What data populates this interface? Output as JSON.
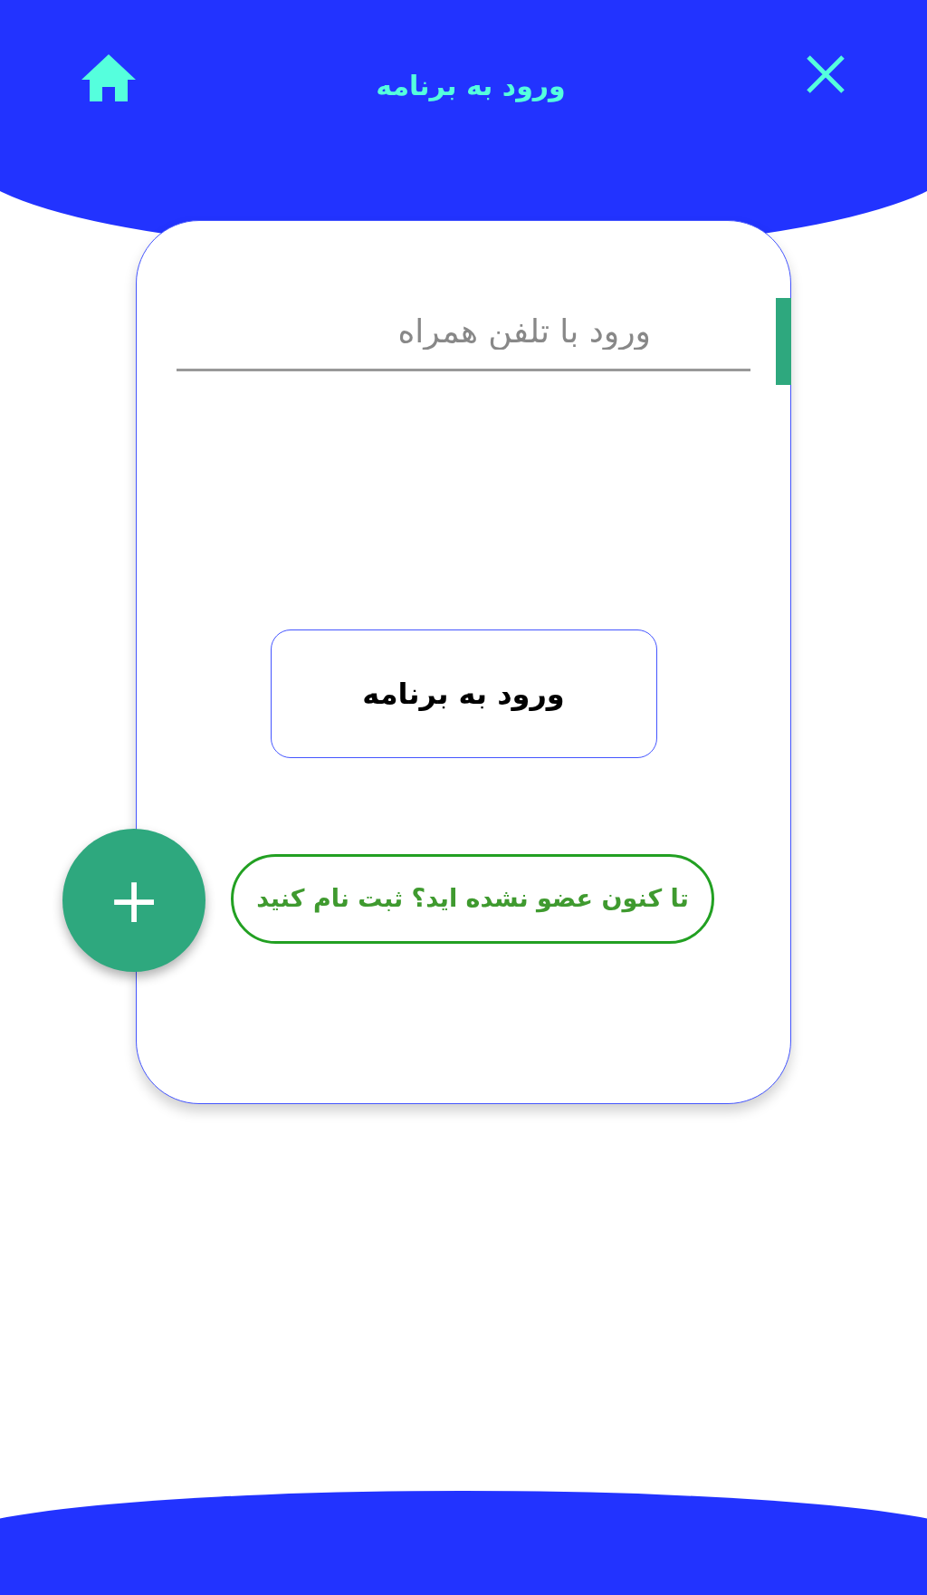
{
  "header": {
    "title": "ورود به برنامه"
  },
  "phone_field": {
    "placeholder": "ورود با تلفن همراه"
  },
  "login_button": {
    "label": "ورود به برنامه"
  },
  "register_link": {
    "label": "تا کنون عضو نشده اید؟ ثبت نام کنید"
  },
  "fab": {
    "label": "+"
  }
}
